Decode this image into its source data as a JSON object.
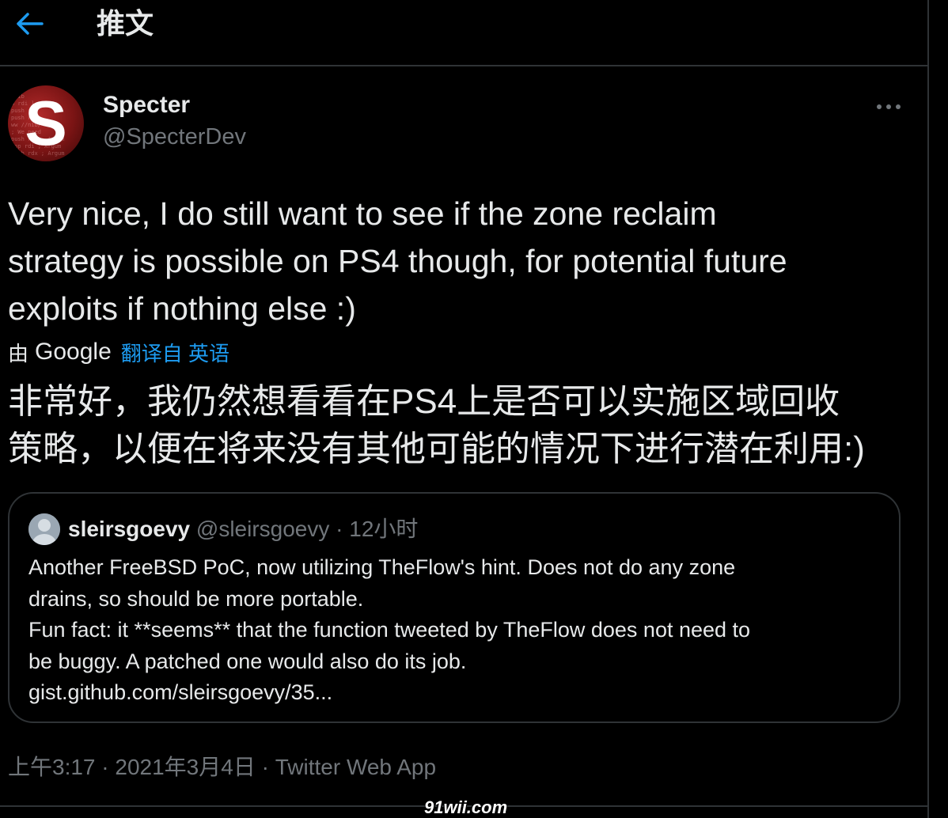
{
  "header": {
    "back_icon": "arrow-left-icon",
    "title": "推文"
  },
  "tweet": {
    "avatar_letter": "S",
    "display_name": "Specter",
    "handle": "@SpecterDev",
    "more_icon": "more-horizontal-icon",
    "text_lines": [
      "Very nice, I do still want to see if the zone reclaim",
      "strategy is possible on PS4 though, for potential future",
      "exploits if nothing else :)"
    ],
    "translation": {
      "by_label": "由",
      "provider": "Google",
      "link_label": "翻译自 英语",
      "lines": [
        "非常好，我仍然想看看在PS4上是否可以实施区域回收",
        "策略，以便在将来没有其他可能的情况下进行潜在利用:)"
      ]
    },
    "timestamp": "上午3:17 · 2021年3月4日 · ",
    "source": "Twitter Web App"
  },
  "quote": {
    "avatar_icon": "default-user-icon",
    "display_name": "sleirsgoevy",
    "handle": "@sleirsgoevy",
    "separator": " · ",
    "time": "12小时",
    "lines": [
      "Another FreeBSD PoC, now utilizing TheFlow's hint. Does not do any zone",
      "drains, so should be more portable.",
      "Fun fact: it **seems** that the function tweeted by TheFlow does not need to",
      "be buggy. A patched one would also do its job.",
      "gist.github.com/sleirsgoevy/35..."
    ]
  },
  "watermark": "91wii.com",
  "colors": {
    "background": "#000000",
    "text": "#e7e9ea",
    "secondary": "#71767b",
    "accent": "#1d9bf0",
    "border": "#2f3336"
  }
}
